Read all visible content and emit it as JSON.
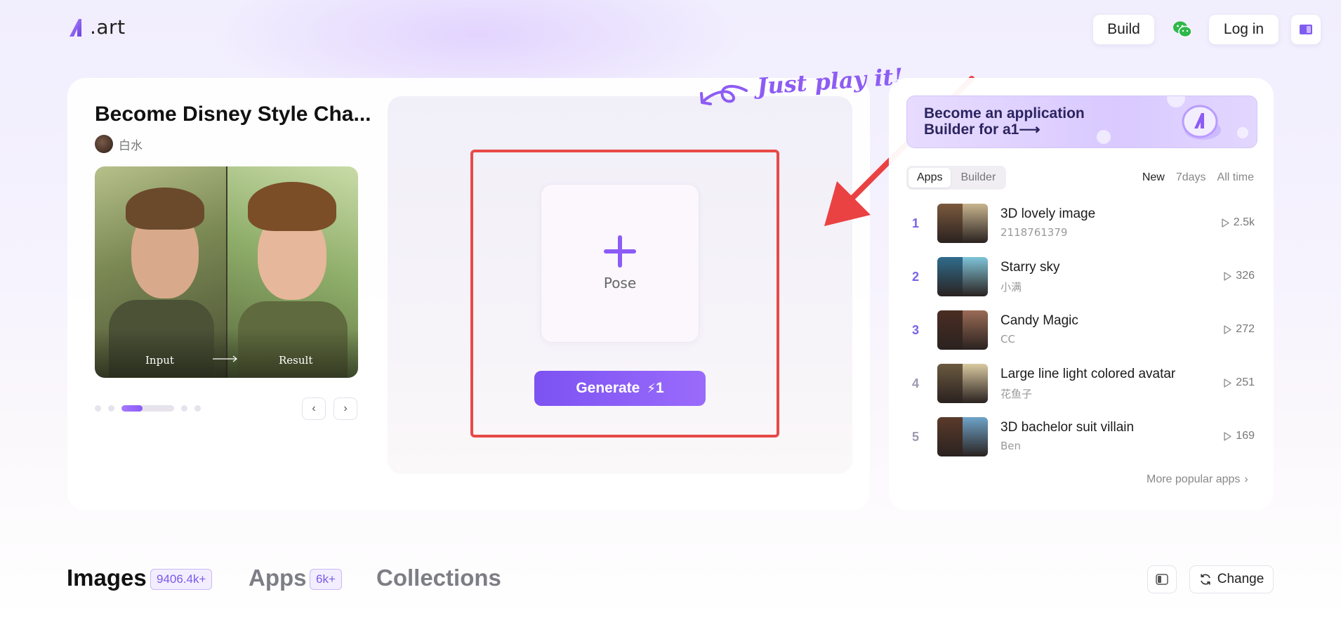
{
  "header": {
    "logo_text": ".art",
    "build_label": "Build",
    "login_label": "Log in"
  },
  "featured": {
    "title": "Become Disney Style Cha...",
    "author": "白水",
    "preview_input_label": "Input",
    "preview_result_label": "Result",
    "carousel": {
      "total": 5,
      "active_index": 2
    }
  },
  "playground": {
    "upload_label": "Pose",
    "generate_label": "Generate",
    "generate_cost": "1",
    "annotation": "Just play it!"
  },
  "side": {
    "promo_text": "Become an application Builder for a1⟶",
    "tabs": [
      {
        "label": "Apps",
        "active": true
      },
      {
        "label": "Builder",
        "active": false
      }
    ],
    "filters": [
      {
        "label": "New",
        "active": true
      },
      {
        "label": "7days",
        "active": false
      },
      {
        "label": "All time",
        "active": false
      }
    ],
    "ranking": [
      {
        "rank": "1",
        "title": "3D lovely image",
        "author": "2118761379",
        "plays": "2.5k",
        "colors": [
          "#7b5a3d",
          "#c8b48e"
        ]
      },
      {
        "rank": "2",
        "title": "Starry sky",
        "author": "小满",
        "plays": "326",
        "colors": [
          "#2f6c8c",
          "#7fc4d8"
        ]
      },
      {
        "rank": "3",
        "title": "Candy Magic",
        "author": "CC",
        "plays": "272",
        "colors": [
          "#4a2d22",
          "#9a6b55"
        ]
      },
      {
        "rank": "4",
        "title": "Large line light colored avatar",
        "author": "花鱼子",
        "plays": "251",
        "colors": [
          "#6b5a40",
          "#d9c9a0"
        ]
      },
      {
        "rank": "5",
        "title": "3D bachelor suit villain",
        "author": "Ben",
        "plays": "169",
        "colors": [
          "#5a3a2a",
          "#6fa3c9"
        ]
      }
    ],
    "more_label": "More popular apps"
  },
  "bottom_tabs": {
    "images_label": "Images",
    "images_count": "9406.4k+",
    "apps_label": "Apps",
    "apps_count": "6k+",
    "collections_label": "Collections",
    "change_label": "Change"
  },
  "colors": {
    "accent": "#8c5cf6",
    "highlight_border": "#e84a48",
    "annotation_arrow": "#ea4242"
  }
}
